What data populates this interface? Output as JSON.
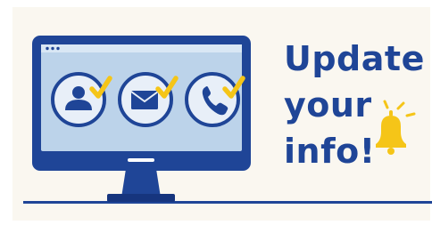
{
  "headline": {
    "line1": "Update",
    "line2": "your",
    "line3": "info!"
  },
  "icons": [
    "person-icon",
    "envelope-icon",
    "phone-icon",
    "checkmark-icon",
    "bell-icon"
  ],
  "colors": {
    "navy": "#1f4597",
    "dark_navy": "#16357e",
    "screen_blue": "#bcd3ea",
    "screen_light": "#d9e7f4",
    "circle_fill": "#e8eff8",
    "accent_yellow": "#f5c518",
    "background": "#faf7f0"
  }
}
